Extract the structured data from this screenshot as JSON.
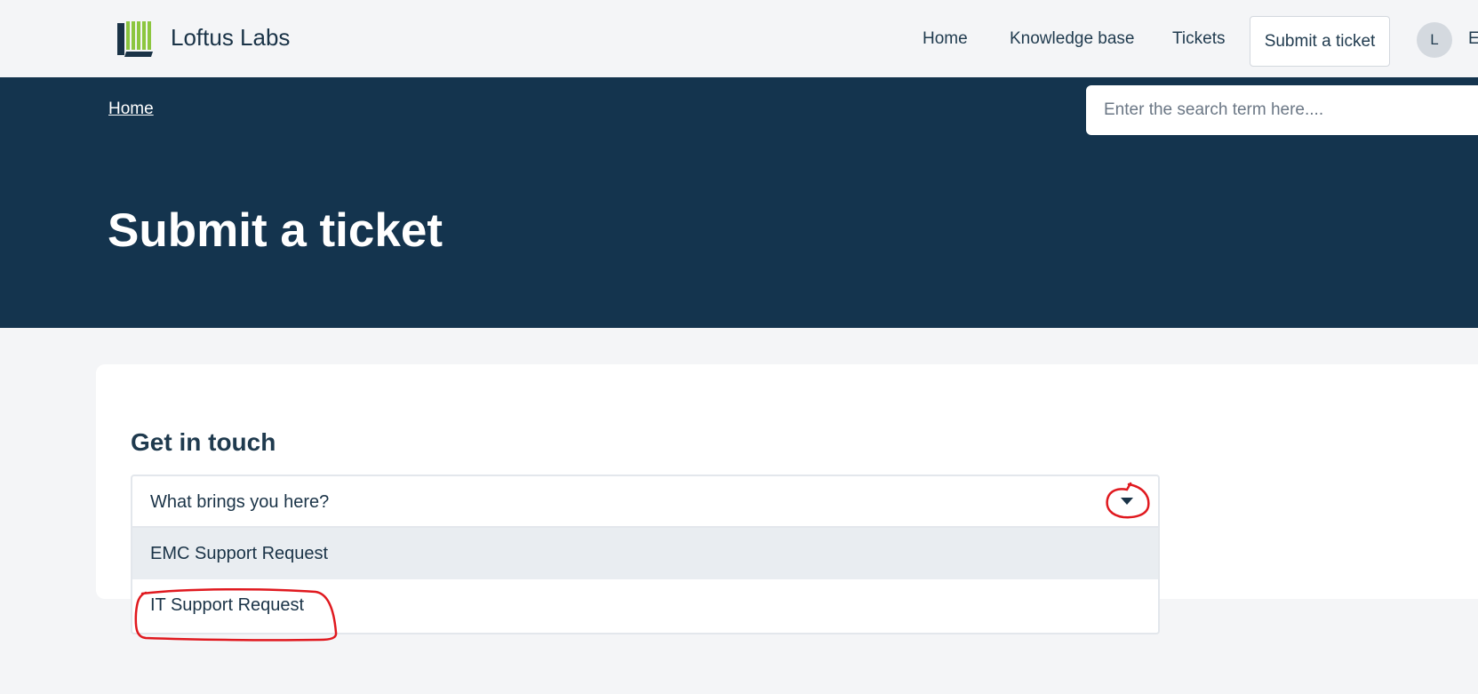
{
  "header": {
    "brand": "Loftus Labs",
    "nav": {
      "home": "Home",
      "knowledge_base": "Knowledge base",
      "tickets": "Tickets",
      "submit": "Submit a ticket"
    },
    "avatar_initial": "L",
    "user_name_truncated": "E"
  },
  "hero": {
    "breadcrumb": "Home",
    "search_placeholder": "Enter the search term here....",
    "title": "Submit a ticket"
  },
  "form": {
    "title": "Get in touch",
    "select_placeholder": "What brings you here?",
    "options": [
      "EMC Support Request",
      "IT Support Request"
    ],
    "highlighted_option_index": 0
  },
  "colors": {
    "hero_bg": "#14344e",
    "page_bg": "#f4f5f7",
    "logo_green": "#8cc63f",
    "annotation_red": "#e0191f"
  },
  "icons": {
    "logo": "loftus-logo-icon",
    "caret": "caret-down-icon"
  }
}
